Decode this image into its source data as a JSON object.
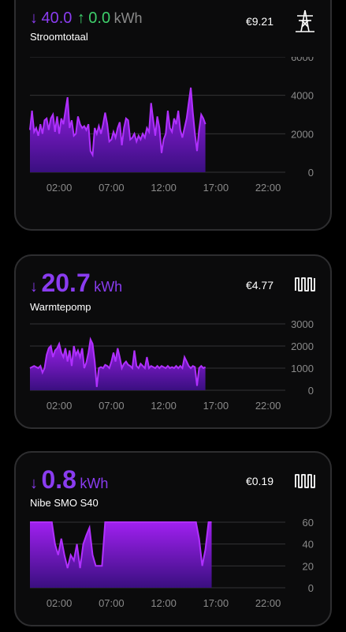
{
  "colors": {
    "import": "#8a3cf0",
    "export": "#3ecf6b",
    "grid": "#333336",
    "axis_text": "#8a8a8a"
  },
  "cards": [
    {
      "import_arrow": "↓",
      "import_value": "40.0",
      "export_arrow": "↑",
      "export_value": "0.0",
      "unit": "kWh",
      "label": "Stroomtotaal",
      "cost": "€9.21",
      "icon": "power-pylon-icon"
    },
    {
      "import_arrow": "↓",
      "import_value": "20.7",
      "unit": "kWh",
      "label": "Warmtepomp",
      "cost": "€4.77",
      "icon": "heat-pump-icon"
    },
    {
      "import_arrow": "↓",
      "import_value": "0.8",
      "unit": "kWh",
      "label": "Nibe SMO S40",
      "cost": "€0.19",
      "icon": "heat-pump-icon"
    }
  ],
  "chart_data": [
    {
      "type": "area",
      "x_ticks": [
        "02:00",
        "07:00",
        "12:00",
        "17:00",
        "22:00"
      ],
      "y_ticks": [
        "0",
        "2000",
        "4000",
        "6000"
      ],
      "ylim": [
        0,
        6000
      ],
      "xlim": [
        0,
        24
      ],
      "x": [
        0,
        0.2,
        0.4,
        0.6,
        0.8,
        1.0,
        1.2,
        1.4,
        1.6,
        1.8,
        2.0,
        2.2,
        2.4,
        2.6,
        2.8,
        3.0,
        3.2,
        3.4,
        3.6,
        3.8,
        4.0,
        4.2,
        4.4,
        4.6,
        4.8,
        5.0,
        5.2,
        5.4,
        5.6,
        5.8,
        6.0,
        6.2,
        6.4,
        6.6,
        6.8,
        7.0,
        7.2,
        7.4,
        7.6,
        7.8,
        8.0,
        8.2,
        8.4,
        8.6,
        8.8,
        9.0,
        9.2,
        9.4,
        9.6,
        9.8,
        10.0,
        10.2,
        10.4,
        10.6,
        10.8,
        11.0,
        11.2,
        11.4,
        11.6,
        11.8,
        12.0,
        12.2,
        12.4,
        12.6,
        12.8,
        13.0,
        13.2,
        13.4,
        13.6,
        13.8,
        14.0,
        14.2,
        14.4,
        14.6,
        14.8,
        15.0,
        15.2,
        15.4,
        15.6,
        15.8,
        16.0,
        16.2,
        16.4,
        16.6,
        16.8
      ],
      "y": [
        2200,
        3200,
        2100,
        2300,
        1900,
        2500,
        2000,
        2700,
        2800,
        2200,
        2800,
        3000,
        2100,
        2900,
        2000,
        2800,
        2500,
        3200,
        3900,
        2300,
        2700,
        1900,
        2000,
        2900,
        2500,
        2300,
        2400,
        2200,
        2500,
        1100,
        900,
        2300,
        2000,
        2400,
        2000,
        2500,
        3100,
        2500,
        1600,
        1700,
        2100,
        1800,
        2300,
        2600,
        1400,
        2300,
        2800,
        2700,
        1700,
        1800,
        2000,
        1600,
        1900,
        1700,
        2000,
        1800,
        2300,
        2100,
        3600,
        2700,
        1900,
        2900,
        2300,
        1000,
        1700,
        2000,
        3200,
        2300,
        2100,
        2800,
        2500,
        3200,
        2200,
        1800,
        2300,
        2800,
        3600,
        4400,
        3100,
        2000,
        1100,
        2200,
        3000,
        2800,
        2500
      ]
    },
    {
      "type": "area",
      "x_ticks": [
        "02:00",
        "07:00",
        "12:00",
        "17:00",
        "22:00"
      ],
      "y_ticks": [
        "0",
        "1000",
        "2000",
        "3000"
      ],
      "ylim": [
        0,
        3000
      ],
      "xlim": [
        0,
        24
      ],
      "x": [
        0,
        0.2,
        0.4,
        0.6,
        0.8,
        1.0,
        1.2,
        1.4,
        1.6,
        1.8,
        2.0,
        2.2,
        2.4,
        2.6,
        2.8,
        3.0,
        3.2,
        3.4,
        3.6,
        3.8,
        4.0,
        4.2,
        4.4,
        4.6,
        4.8,
        5.0,
        5.2,
        5.4,
        5.6,
        5.8,
        6.0,
        6.2,
        6.4,
        6.6,
        6.8,
        7.0,
        7.2,
        7.4,
        7.6,
        7.8,
        8.0,
        8.2,
        8.4,
        8.6,
        8.8,
        9.0,
        9.2,
        9.4,
        9.6,
        9.8,
        10.0,
        10.2,
        10.4,
        10.6,
        10.8,
        11.0,
        11.2,
        11.4,
        11.6,
        11.8,
        12.0,
        12.2,
        12.4,
        12.6,
        12.8,
        13.0,
        13.2,
        13.4,
        13.6,
        13.8,
        14.0,
        14.2,
        14.4,
        14.6,
        14.8,
        15.0,
        15.2,
        15.4,
        15.6,
        15.8,
        16.0,
        16.2,
        16.4,
        16.6,
        16.8
      ],
      "y": [
        1000,
        1050,
        1100,
        1050,
        1000,
        1100,
        800,
        1000,
        1600,
        1900,
        2000,
        1500,
        1800,
        1900,
        2100,
        1700,
        1500,
        1900,
        1300,
        1800,
        1100,
        2000,
        1600,
        1800,
        1500,
        1900,
        1000,
        1250,
        1700,
        2300,
        2100,
        1300,
        150,
        1000,
        1050,
        1000,
        1150,
        1100,
        1000,
        1300,
        1700,
        1300,
        1900,
        1500,
        1000,
        1200,
        1300,
        1150,
        1100,
        1000,
        1800,
        1100,
        1000,
        1200,
        1100,
        1000,
        1500,
        1000,
        1100,
        1050,
        1000,
        1100,
        1000,
        1100,
        1050,
        1000,
        1100,
        1000,
        1050,
        1000,
        1100,
        1000,
        1100,
        1000,
        1500,
        1300,
        1100,
        1000,
        1100,
        1050,
        200,
        1000,
        1100,
        1000,
        1050
      ]
    },
    {
      "type": "area",
      "x_ticks": [
        "02:00",
        "07:00",
        "12:00",
        "17:00",
        "22:00"
      ],
      "y_ticks": [
        "0",
        "20",
        "40",
        "60"
      ],
      "ylim": [
        0,
        60
      ],
      "xlim": [
        0,
        24
      ],
      "x": [
        0,
        0.3,
        0.6,
        0.9,
        1.2,
        1.5,
        1.8,
        2.1,
        2.4,
        2.7,
        3.0,
        3.3,
        3.6,
        3.9,
        4.2,
        4.5,
        4.8,
        5.1,
        5.4,
        5.7,
        6.0,
        6.3,
        6.6,
        6.9,
        7.2,
        7.5,
        7.8,
        8.1,
        8.4,
        8.7,
        9.0,
        9.3,
        9.6,
        9.9,
        10.2,
        10.5,
        10.8,
        11.1,
        11.4,
        11.7,
        12.0,
        12.3,
        12.6,
        12.9,
        13.2,
        13.5,
        13.8,
        14.1,
        14.4,
        14.7,
        15.0,
        15.3,
        15.6,
        15.9,
        16.2,
        16.5,
        16.8,
        17.1,
        17.4
      ],
      "y": [
        60,
        60,
        60,
        60,
        60,
        60,
        60,
        60,
        40,
        30,
        45,
        30,
        18,
        30,
        25,
        40,
        18,
        40,
        48,
        55,
        30,
        20,
        20,
        20,
        60,
        60,
        60,
        60,
        60,
        60,
        60,
        60,
        60,
        60,
        60,
        60,
        60,
        60,
        60,
        60,
        60,
        60,
        60,
        60,
        60,
        60,
        60,
        60,
        60,
        60,
        60,
        60,
        60,
        60,
        45,
        20,
        35,
        60,
        60
      ]
    }
  ]
}
